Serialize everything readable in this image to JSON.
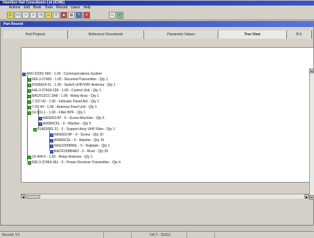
{
  "app": {
    "title": "Hamilton Hall Consultants Ltd (ICWE)"
  },
  "menu": [
    "Actions",
    "Edit",
    "Book",
    "Tools",
    "Record",
    "Users",
    "Help"
  ],
  "toolbar": {
    "buttons": [
      "|<<",
      "<",
      ">",
      ">>|",
      "open",
      "filter",
      "lock",
      "print",
      "?",
      "x",
      "save",
      "ok"
    ]
  },
  "child_window": {
    "title": "Part Record"
  },
  "tabs": [
    "Part Projects",
    "Reference Documents",
    "Parameter Values",
    "Tree View",
    "B K"
  ],
  "tabs_active": "Tree View",
  "tree": [
    {
      "label": "AR0-22001-560 - 1.00 - Communications System",
      "icon": "folder-icon"
    },
    {
      "label": "660-3-27400 - 1.00 - Receiver/Transmitter - Qty 1",
      "icon": "part-icon"
    },
    {
      "label": "RS66624-21 - 1.00 - Switch UHF/VHF Antenna - Qty 1",
      "icon": "part-icon"
    },
    {
      "label": "646-3-27434-199 - 1.00 - Control Unit - Qty 1",
      "icon": "part-icon"
    },
    {
      "label": "BACR13CC-2A8 - 1.00 - Relay Assy - Qty 1",
      "icon": "part-icon"
    },
    {
      "label": "7-337-42 - 1.00 - Indicator Panel Ant - Qty 1",
      "icon": "part-icon"
    },
    {
      "label": "7-25-44 - 1.00 - Antenna Feed Unit - Qty 1",
      "icon": "part-icon"
    },
    {
      "label": "10-531-1 - 1.00 - Filter BPF - Qty 1",
      "icon": "part-icon"
    },
    {
      "label": "NAS603-6P - 0 - Screw Machine - Qty 5",
      "icon": "part-icon"
    },
    {
      "label": "AN960C6L - 0 - Washer - Qty 5",
      "icon": "part-icon"
    },
    {
      "label": "414E5081-21 - 0 - Support Assy UHF Filter - Qty 1",
      "icon": "part-icon"
    },
    {
      "label": "NAS603-8P - 0 - Screw - Qty 10",
      "icon": "part-icon"
    },
    {
      "label": "AN960C6L - 0 - Washer - Qty 10",
      "icon": "part-icon"
    },
    {
      "label": "NAS1050BN6L - 0 - Nutplate - Qty 1",
      "icon": "part-icon"
    },
    {
      "label": "BACR15BB4AD - 0 - Rivet - Qty 20",
      "icon": "part-icon"
    },
    {
      "label": "10-404-5 - 1.00 - Relay Antenna - Qty 1",
      "icon": "part-icon"
    },
    {
      "label": "636-3-37464-36L - 0 - Power Receiver Transmitter - Qty 4",
      "icon": "part-icon"
    }
  ],
  "status": {
    "record": "Record: V3",
    "right": "DICT - EDG3"
  }
}
